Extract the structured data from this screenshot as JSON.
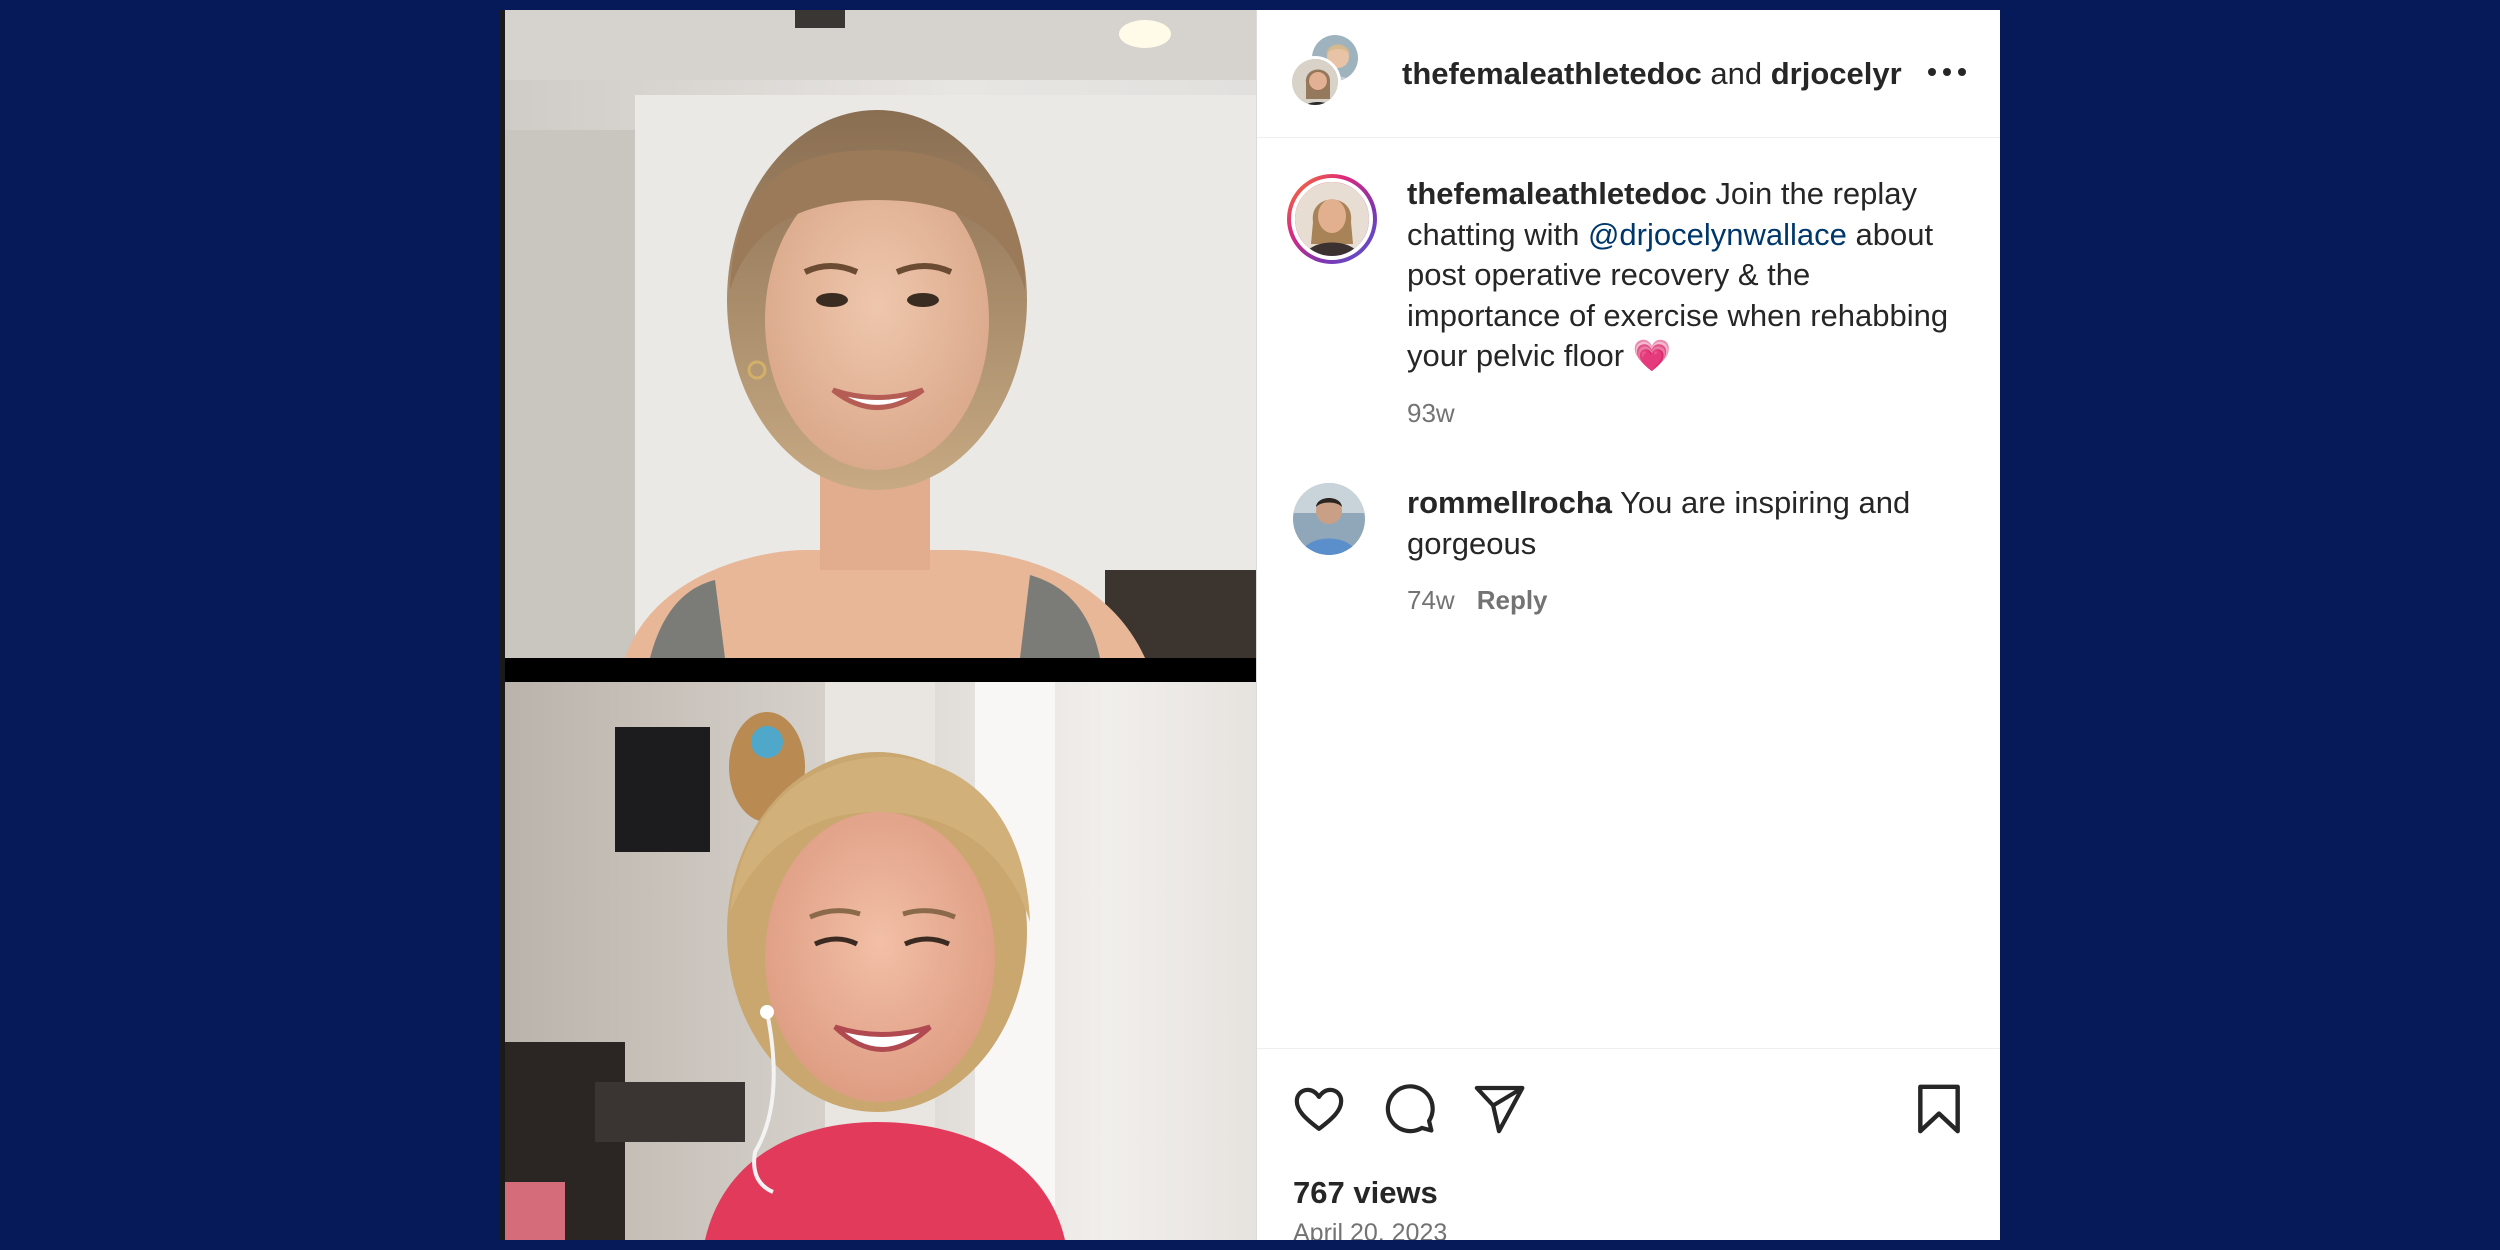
{
  "header": {
    "user1": "thefemaleathletedoc",
    "joiner": "and",
    "user2": "drjocelyr",
    "more_icon": "more-horizontal-icon"
  },
  "caption": {
    "username": "thefemaleathletedoc",
    "text_before": "Join the replay chatting with",
    "mention": "@drjocelynwallace",
    "text_after": "about post operative recovery & the importance of exercise when rehabbing your pelvic floor",
    "emoji": "💗",
    "age": "93w"
  },
  "comments": [
    {
      "username": "rommellrocha",
      "text": "You are inspiring and gorgeous",
      "age": "74w",
      "reply_label": "Reply"
    }
  ],
  "actions": {
    "icons": [
      "heart-icon",
      "comment-icon",
      "share-icon",
      "bookmark-icon"
    ]
  },
  "stats": {
    "views": "767 views",
    "date": "April 20, 2023"
  },
  "colors": {
    "background": "#061a5a",
    "mention": "#00376b",
    "secondary_text": "#737373"
  }
}
